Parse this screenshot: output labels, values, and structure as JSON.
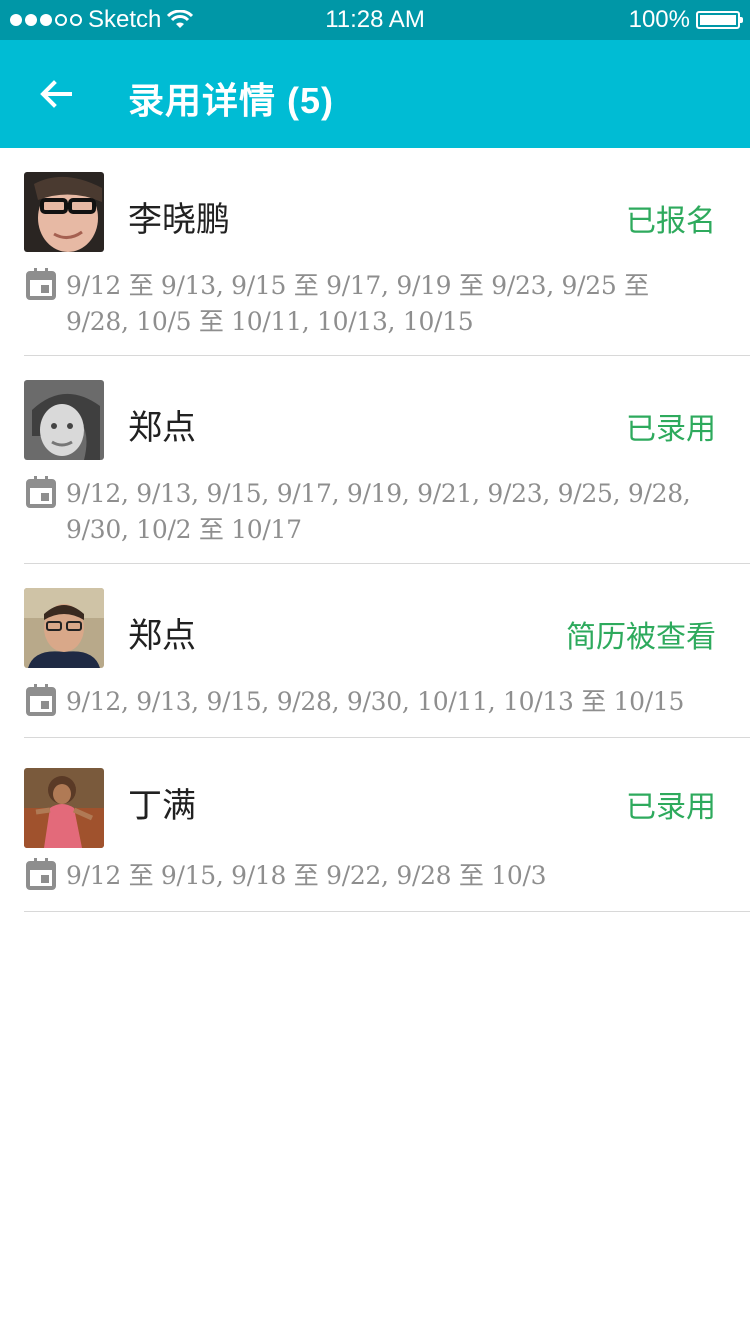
{
  "statusbar": {
    "carrier": "Sketch",
    "time": "11:28 AM",
    "battery": "100%"
  },
  "appbar": {
    "title": "录用详情 (5)",
    "back_icon": "arrow-left-icon"
  },
  "colors": {
    "statusbar": "#0097a7",
    "appbar": "#00bcd4",
    "status_text": "#2eaa5d",
    "date_text": "#8e8e8e"
  },
  "candidates": [
    {
      "name": "李晓鹏",
      "status": "已报名",
      "dates": "9/12 至 9/13, 9/15 至 9/17, 9/19 至 9/23, 9/25 至 9/28, 10/5 至 10/11, 10/13, 10/15"
    },
    {
      "name": "郑点",
      "status": "已录用",
      "dates": "9/12, 9/13, 9/15, 9/17, 9/19, 9/21, 9/23, 9/25, 9/28, 9/30, 10/2 至 10/17"
    },
    {
      "name": "郑点",
      "status": "简历被查看",
      "dates": "9/12, 9/13, 9/15, 9/28, 9/30, 10/11, 10/13 至 10/15"
    },
    {
      "name": "丁满",
      "status": "已录用",
      "dates": "9/12 至 9/15, 9/18 至 9/22, 9/28 至 10/3"
    }
  ]
}
